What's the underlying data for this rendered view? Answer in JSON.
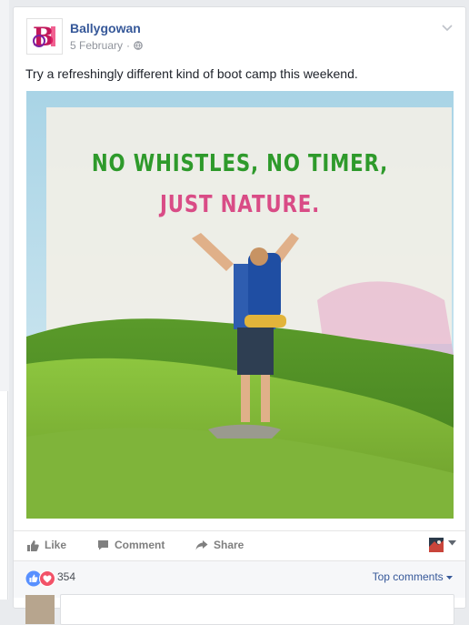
{
  "post": {
    "page_name": "Ballygowan",
    "date": "5 February",
    "separator": "·",
    "text": "Try a refreshingly different kind of boot camp this weekend.",
    "image": {
      "headline_line1": "NO WHISTLES, NO TIMER,",
      "headline_line2": "JUST NATURE."
    }
  },
  "actions": {
    "like": "Like",
    "comment": "Comment",
    "share": "Share"
  },
  "reactions": {
    "count": "354",
    "top_comments": "Top comments"
  },
  "colors": {
    "link": "#365899",
    "headline_green": "#2e9a2b",
    "headline_pink": "#d94c86",
    "like_blue": "#5890ff",
    "love_red": "#f25268"
  }
}
